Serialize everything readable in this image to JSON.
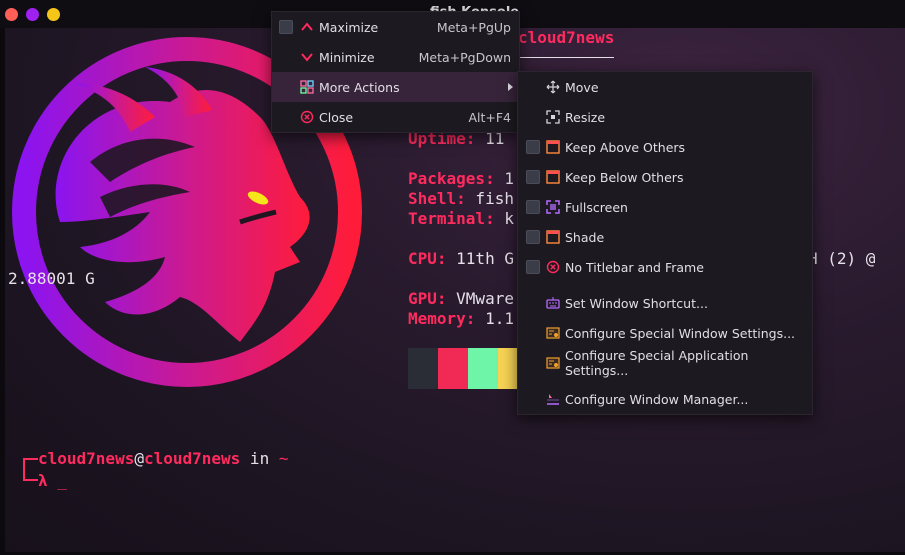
{
  "window": {
    "title": "fish  Konsole"
  },
  "neofetch": {
    "userhost": "cloud7news",
    "left_fragment": "2.88001 G",
    "lines": [
      {
        "key": "Uptime:",
        "value": " 11"
      },
      {
        "key": "Packages:",
        "value": " 1"
      },
      {
        "key": "Shell:",
        "value": " fish"
      },
      {
        "key": "Terminal:",
        "value": " k"
      },
      {
        "key": "CPU:",
        "value": " 11th G"
      },
      {
        "key": "GPU:",
        "value": " VMware"
      },
      {
        "key": "Memory:",
        "value": " 1.1"
      }
    ],
    "cpu_tail": "H (2) @",
    "swatches": [
      "#2a2d35",
      "#f02a55",
      "#6ff5a8",
      "#f7d354"
    ]
  },
  "prompt": {
    "user": "cloud7news",
    "at": "@",
    "host": "cloud7news",
    "in_text": " in ",
    "dir": "~",
    "lambda": "λ",
    "cursor": "_"
  },
  "menu_main": {
    "items": [
      {
        "label": "Maximize",
        "shortcut": "Meta+PgUp",
        "icon": "chevron-up-icon"
      },
      {
        "label": "Minimize",
        "shortcut": "Meta+PgDown",
        "icon": "chevron-down-icon"
      },
      {
        "label": "More Actions",
        "shortcut": "",
        "icon": "grid-icon"
      },
      {
        "label": "Close",
        "shortcut": "Alt+F4",
        "icon": "close-circle-icon"
      }
    ]
  },
  "menu_more": {
    "items": [
      {
        "label": "Move",
        "icon": "move-icon"
      },
      {
        "label": "Resize",
        "icon": "resize-icon"
      },
      {
        "label": "Keep Above Others",
        "icon": "window-above-icon"
      },
      {
        "label": "Keep Below Others",
        "icon": "window-below-icon"
      },
      {
        "label": "Fullscreen",
        "icon": "fullscreen-icon"
      },
      {
        "label": "Shade",
        "icon": "shade-icon"
      },
      {
        "label": "No Titlebar and Frame",
        "icon": "close-circle-icon"
      },
      {
        "label": "Set Window Shortcut...",
        "icon": "keyboard-icon"
      },
      {
        "label": "Configure Special Window Settings...",
        "icon": "window-settings-icon"
      },
      {
        "label": "Configure Special Application Settings...",
        "icon": "app-settings-icon"
      },
      {
        "label": "Configure Window Manager...",
        "icon": "window-manager-icon"
      }
    ]
  },
  "colors": {
    "accent": "#ff2b5e",
    "menu_bg": "#1d1920",
    "menu_hover": "#37243a"
  }
}
